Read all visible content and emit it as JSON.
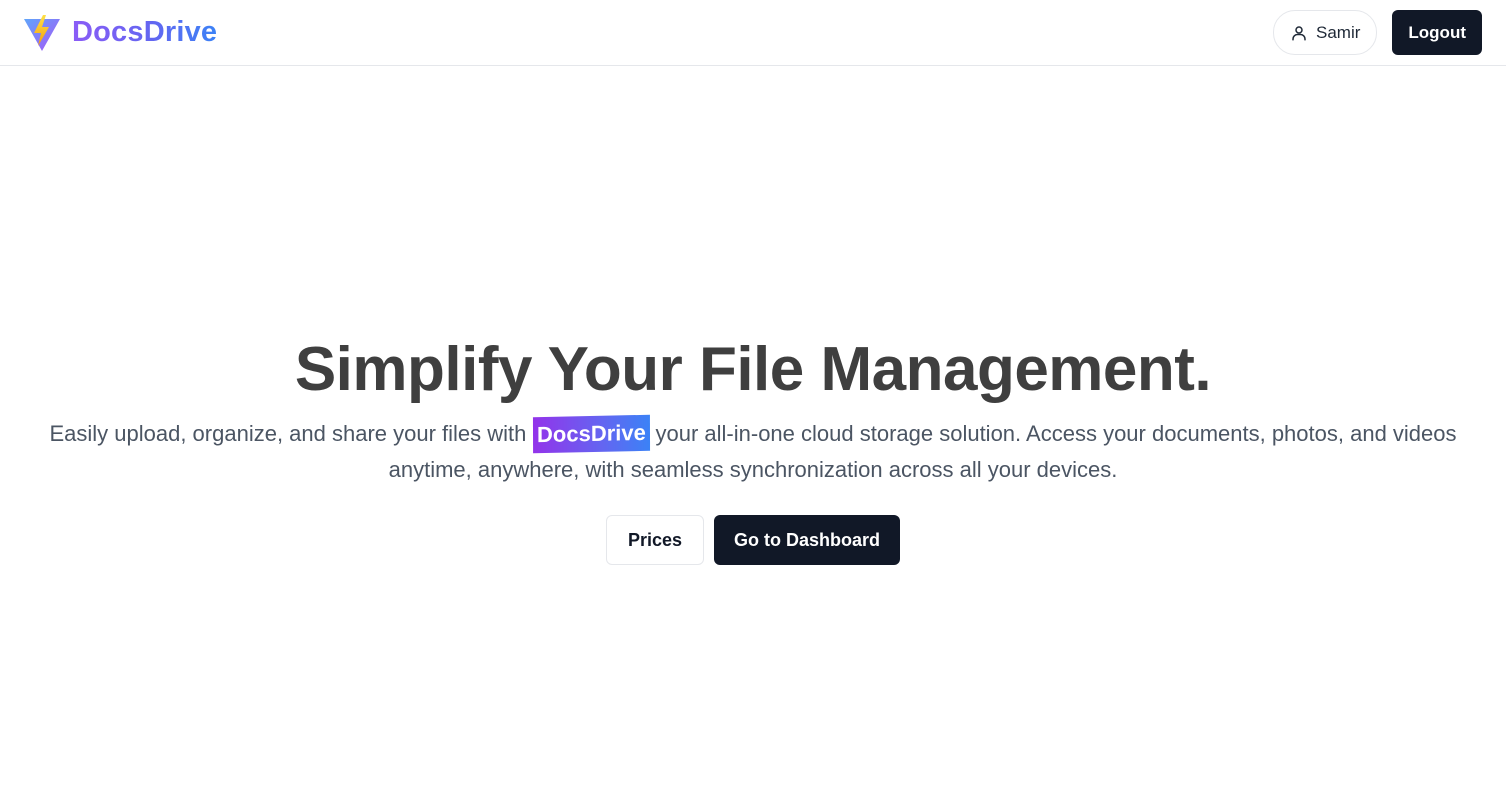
{
  "header": {
    "logo_icon": "bolt-triangle-logo-icon",
    "brand_name": "DocsDrive",
    "user_icon": "user-icon",
    "user_name": "Samir",
    "logout_label": "Logout"
  },
  "hero": {
    "title": "Simplify Your File Management.",
    "desc_before": "Easily upload, organize, and share your files with",
    "desc_highlight": "DocsDrive",
    "desc_after": "your all-in-one cloud storage solution. Access your documents, photos, and videos anytime, anywhere, with seamless synchronization across all your devices.",
    "prices_label": "Prices",
    "dashboard_label": "Go to Dashboard"
  },
  "colors": {
    "brand_gradient_start": "#8b5cf6",
    "brand_gradient_end": "#3b82f6",
    "dark_button": "#111827",
    "title_text": "#3f3f3f"
  }
}
